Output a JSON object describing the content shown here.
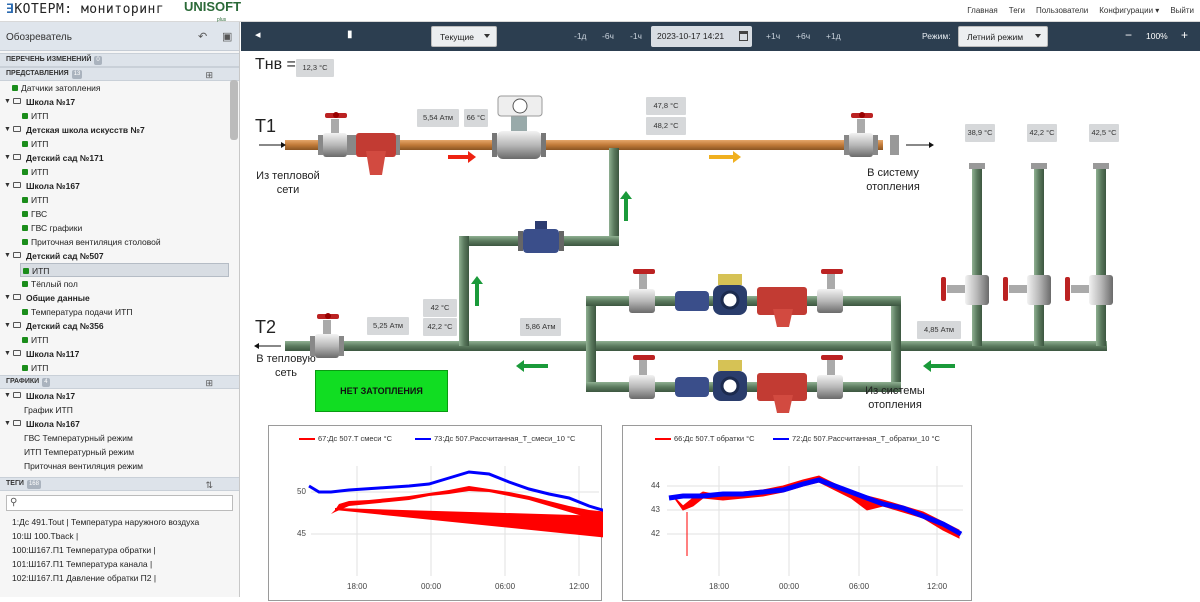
{
  "app": {
    "title": "КОТЕРМ: мониторинг",
    "brand": "UNISOFT",
    "brand_sub": "plus",
    "nav": [
      "Главная",
      "Теги",
      "Пользователи",
      "Конфигурации ▾",
      "Выйти"
    ]
  },
  "sidebar": {
    "title": "Обозреватель",
    "changes_label": "ПЕРЕЧЕНЬ ИЗМЕНЕНИЙ",
    "changes_count": "0",
    "views_label": "ПРЕДСТАВЛЕНИЯ",
    "views_count": "13",
    "tree": [
      {
        "label": "Датчики затопления",
        "level": 0,
        "kind": "leaf"
      },
      {
        "label": "Школа №17",
        "level": 0,
        "kind": "folder"
      },
      {
        "label": "ИТП",
        "level": 1,
        "kind": "leaf"
      },
      {
        "label": "Детская школа искусств №7",
        "level": 0,
        "kind": "folder"
      },
      {
        "label": "ИТП",
        "level": 1,
        "kind": "leaf"
      },
      {
        "label": "Детский сад №171",
        "level": 0,
        "kind": "folder"
      },
      {
        "label": "ИТП",
        "level": 1,
        "kind": "leaf"
      },
      {
        "label": "Школа №167",
        "level": 0,
        "kind": "folder"
      },
      {
        "label": "ИТП",
        "level": 1,
        "kind": "leaf"
      },
      {
        "label": "ГВС",
        "level": 1,
        "kind": "leaf"
      },
      {
        "label": "ГВС графики",
        "level": 1,
        "kind": "leaf"
      },
      {
        "label": "Приточная вентиляция столовой",
        "level": 1,
        "kind": "leaf"
      },
      {
        "label": "Детский сад №507",
        "level": 0,
        "kind": "folder"
      },
      {
        "label": "ИТП",
        "level": 1,
        "kind": "leaf",
        "selected": true
      },
      {
        "label": "Тёплый пол",
        "level": 1,
        "kind": "leaf"
      },
      {
        "label": "Общие данные",
        "level": 0,
        "kind": "folder"
      },
      {
        "label": "Температура подачи ИТП",
        "level": 1,
        "kind": "leaf"
      },
      {
        "label": "Детский сад №356",
        "level": 0,
        "kind": "folder"
      },
      {
        "label": "ИТП",
        "level": 1,
        "kind": "leaf"
      },
      {
        "label": "Школа №117",
        "level": 0,
        "kind": "folder"
      },
      {
        "label": "ИТП",
        "level": 1,
        "kind": "leaf"
      }
    ],
    "graphs_label": "ГРАФИКИ",
    "graphs_count": "4",
    "graphs": [
      {
        "label": "Школа №17",
        "level": 0,
        "kind": "folder"
      },
      {
        "label": "График ИТП",
        "level": 1,
        "kind": "plain"
      },
      {
        "label": "Школа №167",
        "level": 0,
        "kind": "folder"
      },
      {
        "label": "ГВС Температурный режим",
        "level": 1,
        "kind": "plain"
      },
      {
        "label": "ИТП Температурный режим",
        "level": 1,
        "kind": "plain"
      },
      {
        "label": "Приточная вентиляция режим",
        "level": 1,
        "kind": "plain"
      }
    ],
    "tags_label": "ТЕГИ",
    "tags_count": "168",
    "search_placeholder": "",
    "tags": [
      "1:Дс 491.Tout | Температура наружного воздуха",
      "10:Ш 100.Tback |",
      "100:Ш167.П1 Температура обратки |",
      "101:Ш167.П1 Температура канала |",
      "102:Ш167.П1 Давление обратки П2 |"
    ]
  },
  "toolbar": {
    "mode_select": "Текущие",
    "steps_back": [
      "-1д",
      "-6ч",
      "-1ч"
    ],
    "datetime": "2023-10-17 14:21",
    "steps_fwd": [
      "+1ч",
      "+6ч",
      "+1д"
    ],
    "regime_label": "Режим:",
    "regime_value": "Летний режим",
    "zoom": "100%",
    "zoom_minus": "−",
    "zoom_plus": "+"
  },
  "scheme": {
    "tnv_label": "Тнв =",
    "tnv_value": "12,3 °C",
    "t1_label": "T1",
    "t2_label": "T2",
    "t1_from": [
      "Из тепловой",
      "сети"
    ],
    "t1_to": [
      "В систему",
      "отопления"
    ],
    "t2_to": [
      "В тепловую",
      "сеть"
    ],
    "t2_from": [
      "Из системы",
      "отопления"
    ],
    "t1_pressure": "5,54 Атм",
    "t1_temp": "66 °C",
    "t1_temp_a": "47,8 °C",
    "t1_temp_b": "48,2 °C",
    "branch_temps": [
      "38,9 °C",
      "42,2 °C",
      "42,5 °C"
    ],
    "t2_pressure": "5,25 Атм",
    "t2_temp_a": "42 °C",
    "t2_temp_b": "42,2 °C",
    "mix_pressure": "5,86 Атм",
    "return_pressure": "4,85 Атм",
    "alarm": "НЕТ ЗАТОПЛЕНИЯ",
    "colors": {
      "supply": "#c07a38",
      "return": "#5b7a5e",
      "alarm": "#11dd22"
    }
  },
  "charts": {
    "chart_data": [
      {
        "type": "line",
        "series": [
          {
            "name": "67:Дс 507.T смеси °C",
            "color": "#ff0000"
          },
          {
            "name": "73:Дс 507.Рассчитанная_T_смеси_10 °C",
            "color": "#0000ff"
          }
        ],
        "x_ticks": [
          "18:00",
          "00:00",
          "06:00",
          "12:00"
        ],
        "y_ticks": [
          "45",
          "50"
        ]
      },
      {
        "type": "line",
        "series": [
          {
            "name": "66:Дс 507.T обратки °C",
            "color": "#ff0000"
          },
          {
            "name": "72:Дс 507.Рассчитанная_T_обратки_10 °C",
            "color": "#0000ff"
          }
        ],
        "x_ticks": [
          "18:00",
          "00:00",
          "06:00",
          "12:00"
        ],
        "y_ticks": [
          "42",
          "43",
          "44"
        ]
      }
    ]
  }
}
